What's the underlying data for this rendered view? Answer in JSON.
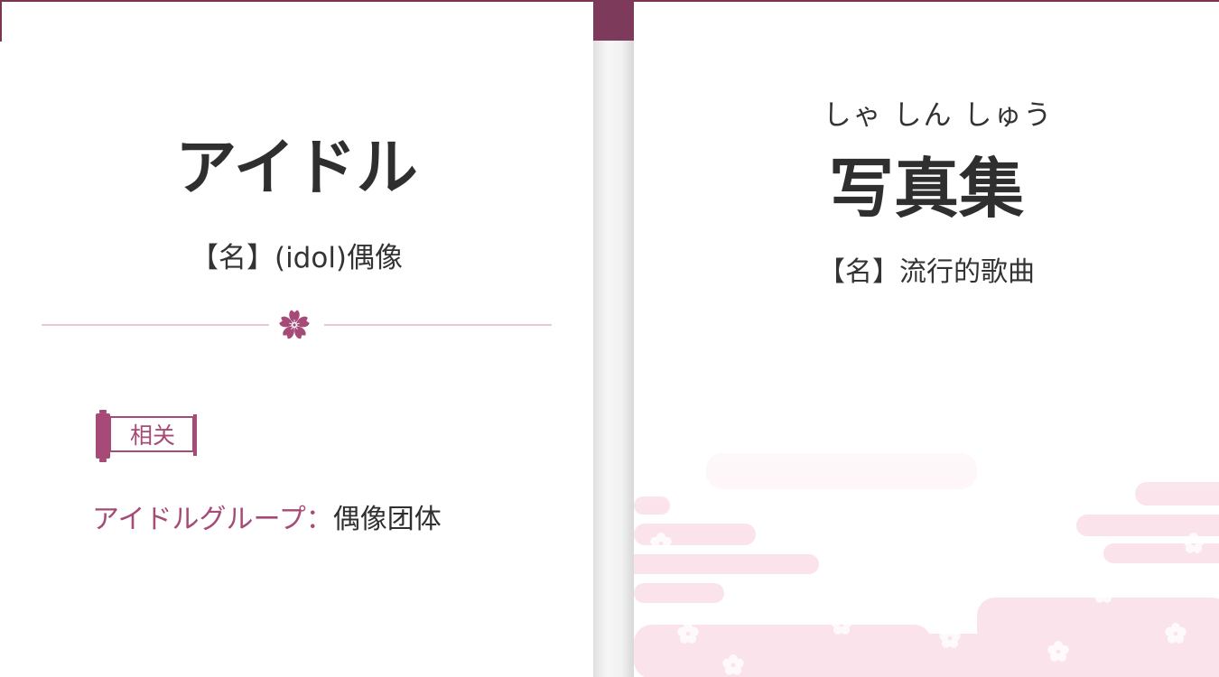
{
  "left_card": {
    "word": "アイドル",
    "definition": "【名】(idol)偶像",
    "related": {
      "tag_label": "相关",
      "items": [
        {
          "term": "アイドルグループ",
          "separator": "：",
          "meaning": "偶像团体"
        }
      ]
    }
  },
  "right_card": {
    "reading": "しゃ しん しゅう",
    "word": "写真集",
    "definition": "【名】流行的歌曲"
  },
  "icons": [
    "sakura-flower-icon",
    "scroll-tag-icon"
  ],
  "colors": {
    "accent": "#a64a78",
    "accent_dark": "#7e3a5a",
    "text": "#2f2f2f",
    "divider": "#e6c8d4",
    "pattern_pink": "#fbe3ec"
  }
}
